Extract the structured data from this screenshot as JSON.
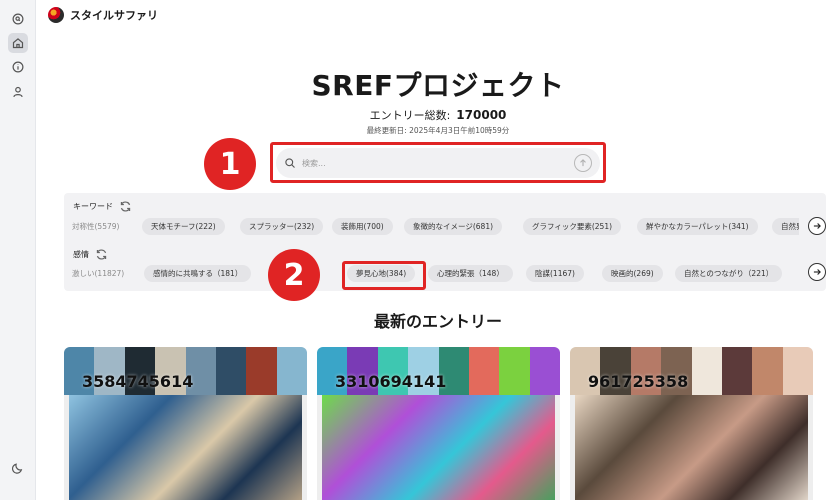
{
  "app": {
    "name": "スタイルサファリ"
  },
  "sidebar": {
    "items": [
      {
        "icon": "search-icon"
      },
      {
        "icon": "home-icon",
        "active": true
      },
      {
        "icon": "info-icon"
      },
      {
        "icon": "user-icon"
      }
    ],
    "bottom_icon": "moon-icon"
  },
  "hero": {
    "title": "SREFプロジェクト",
    "count_label": "エントリー総数:",
    "count_value": "170000",
    "updated": "最終更新日: 2025年4月3日午前10時59分"
  },
  "search": {
    "placeholder": "検索..."
  },
  "annotations": {
    "badge_1": "1",
    "badge_2": "2",
    "color": "#e02424"
  },
  "keywords": {
    "label": "キーワード",
    "chips": [
      "対称性(5579)",
      "天体モチーフ(222)",
      "スプラッター(232)",
      "装飾用(700)",
      "象徴的なイメージ(681)",
      "グラフィック要素(251)",
      "鮮やかなカラーパレット(341)",
      "自然界"
    ]
  },
  "emotions": {
    "label": "感情",
    "chips": [
      "激しい(11827)",
      "感情的に共鳴する（181）",
      "夢見心地(384)",
      "心理的緊張（148）",
      "陰謀(1167)",
      "映画的(269)",
      "自然とのつながり（221）"
    ]
  },
  "latest": {
    "title": "最新のエントリー",
    "cards": [
      {
        "sref": "3584745614",
        "palette": [
          "#4e86a8",
          "#9fb7c6",
          "#1f2b33",
          "#c9c2b2",
          "#6f8fa6",
          "#2f4d66",
          "#9a3b2a",
          "#86b6cf"
        ]
      },
      {
        "sref": "3310694141",
        "palette": [
          "#3aa5c8",
          "#7a3bb5",
          "#3ec7b1",
          "#9ed0e4",
          "#2e8a73",
          "#e36a5c",
          "#7bd13f",
          "#9a4fd3"
        ]
      },
      {
        "sref": "961725358",
        "palette": [
          "#d9c6b1",
          "#4a4238",
          "#b57a67",
          "#7d6352",
          "#efe7dc",
          "#5c3a3a",
          "#c1876a",
          "#e8cbb8"
        ]
      }
    ]
  }
}
